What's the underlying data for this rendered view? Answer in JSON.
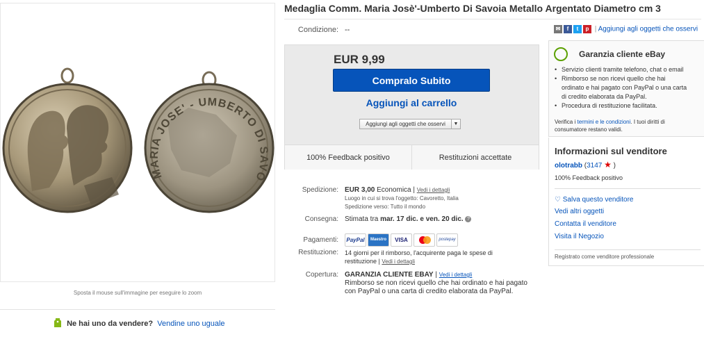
{
  "title": "Medaglia Comm. Maria Josè'-Umberto Di Savoia Metallo Argentato Diametro cm 3",
  "image": {
    "zoom_hint": "Sposta il mouse sull'immagine per eseguire lo zoom",
    "medal_right_text": "MARIA JOSE' - UMBERTO DI SAVOIA"
  },
  "sell_prompt": {
    "question": "Ne hai uno da vendere?",
    "link": "Vendine uno uguale"
  },
  "condition": {
    "label": "Condizione:",
    "value": "--"
  },
  "buy_box": {
    "price": "EUR 9,99",
    "buy_now": "Compralo Subito",
    "add_to_cart": "Aggiungi al carrello",
    "watch": "Aggiungi agli oggetti che osservi",
    "feedback": "100% Feedback positivo",
    "returns": "Restituzioni accettate"
  },
  "details": {
    "shipping": {
      "label": "Spedizione:",
      "price": "EUR 3,00",
      "method": "Economica",
      "details_link": "Vedi i dettagli",
      "location": "Luogo in cui si trova l'oggetto: Cavoretto, Italia",
      "ships_to": "Spedizione verso: Tutto il mondo"
    },
    "delivery": {
      "label": "Consegna:",
      "prefix": "Stimata tra",
      "range": "mar. 17 dic. e ven. 20 dic."
    },
    "payments": {
      "label": "Pagamenti:",
      "methods": [
        "PayPal",
        "Maestro",
        "VISA",
        "MasterCard",
        "postepay"
      ]
    },
    "returns": {
      "label": "Restituzione:",
      "line1": "14 giorni per il rimborso, l'acquirente paga le spese di",
      "line2": "restituzione",
      "details_link": "Vedi i dettagli"
    },
    "coverage": {
      "label": "Copertura:",
      "title": "GARANZIA CLIENTE EBAY",
      "details_link": "Vedi i dettagli",
      "line1": "Rimborso se non ricevi quello che hai ordinato e hai pagato",
      "line2": "con PayPal o una carta di credito elaborata da PayPal."
    }
  },
  "share": {
    "watch_link": "Aggiungi agli oggetti che osservi"
  },
  "guarantee": {
    "title": "Garanzia cliente eBay",
    "items": [
      "Servizio clienti tramite telefono, chat o email",
      "Rimborso se non ricevi quello che hai",
      "ordinato e hai pagato con PayPal o una carta",
      "di credito elaborata da PayPal.",
      "Procedura di restituzione facilitata."
    ],
    "note_pre": "Verifica i",
    "note_link": "termini e le condizioni",
    "note_post": ". I tuoi diritti di",
    "note_line2": "consumatore restano validi."
  },
  "seller": {
    "title": "Informazioni sul venditore",
    "username": "olotrabb",
    "score": "3147",
    "feedback": "100% Feedback positivo",
    "save": "Salva questo venditore",
    "other_items": "Vedi altri oggetti",
    "contact": "Contatta il venditore",
    "store": "Visita il Negozio",
    "registered": "Registrato come venditore professionale"
  },
  "colors": {
    "link": "#0654ba",
    "buy_button": "#0654ba",
    "guarantee_green": "#5ba000"
  }
}
